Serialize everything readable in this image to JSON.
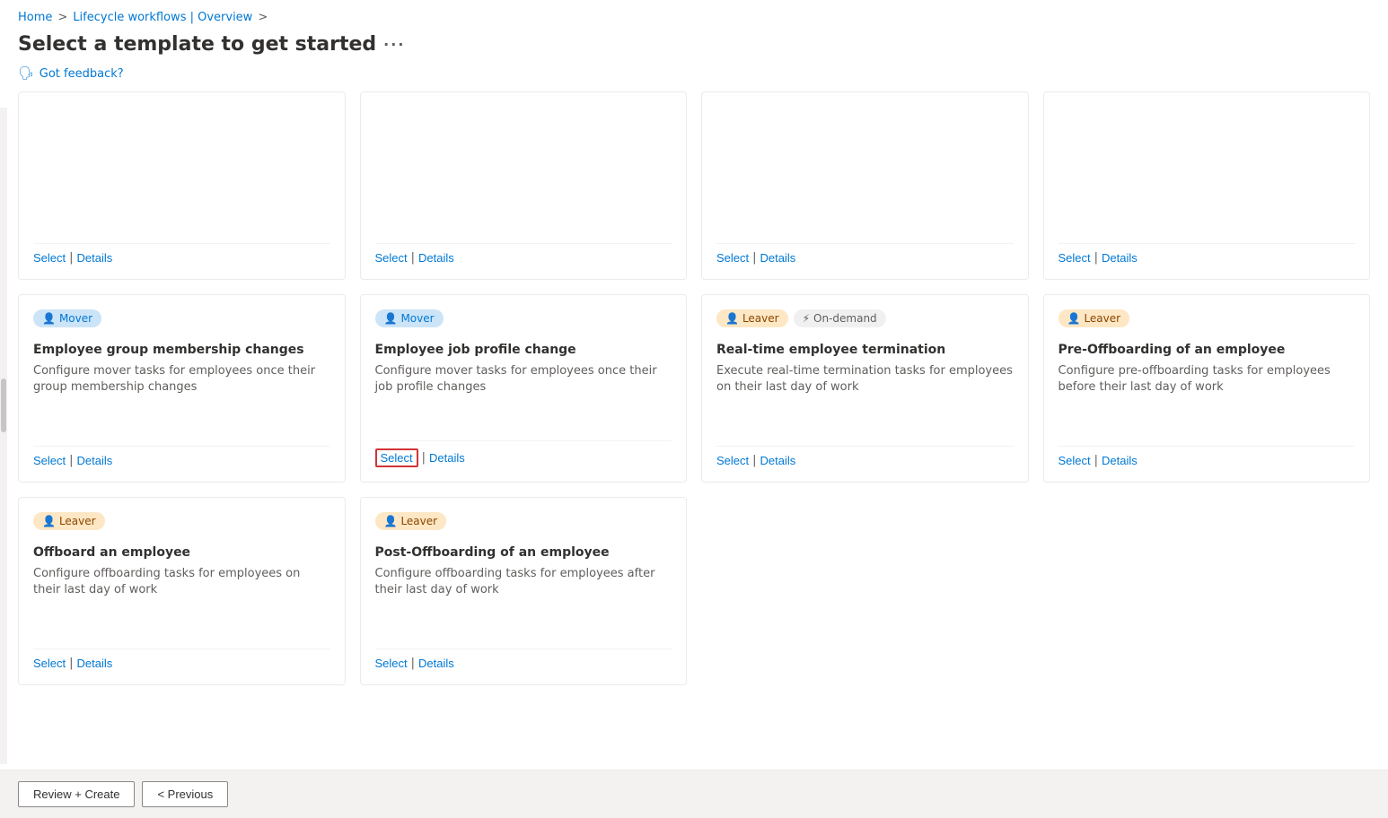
{
  "breadcrumb": {
    "home": "Home",
    "separator1": ">",
    "lifecycle": "Lifecycle workflows | Overview",
    "separator2": ">"
  },
  "page": {
    "title": "Select a template to get started",
    "more_label": "···",
    "feedback_label": "Got feedback?"
  },
  "cards": [
    {
      "id": "card-1",
      "badge_type": "joiner",
      "badge_label": "",
      "title": "",
      "desc": "",
      "select_label": "Select",
      "details_label": "Details",
      "highlighted": false
    },
    {
      "id": "card-2",
      "badge_type": "joiner",
      "badge_label": "",
      "title": "",
      "desc": "",
      "select_label": "Select",
      "details_label": "Details",
      "highlighted": false
    },
    {
      "id": "card-3",
      "badge_type": "joiner",
      "badge_label": "",
      "title": "",
      "desc": "",
      "select_label": "Select",
      "details_label": "Details",
      "highlighted": false
    },
    {
      "id": "card-4",
      "badge_type": "joiner",
      "badge_label": "",
      "title": "",
      "desc": "",
      "select_label": "Select",
      "details_label": "Details",
      "highlighted": false
    },
    {
      "id": "card-5",
      "badges": [
        {
          "type": "mover",
          "label": "Mover",
          "icon": "person"
        }
      ],
      "title": "Employee group membership changes",
      "desc": "Configure mover tasks for employees once their group membership changes",
      "select_label": "Select",
      "details_label": "Details",
      "highlighted": false
    },
    {
      "id": "card-6",
      "badges": [
        {
          "type": "mover",
          "label": "Mover",
          "icon": "person"
        }
      ],
      "title": "Employee job profile change",
      "desc": "Configure mover tasks for employees once their job profile changes",
      "select_label": "Select",
      "details_label": "Details",
      "highlighted": true
    },
    {
      "id": "card-7",
      "badges": [
        {
          "type": "leaver",
          "label": "Leaver",
          "icon": "person"
        },
        {
          "type": "ondemand",
          "label": "On-demand",
          "icon": "lightning"
        }
      ],
      "title": "Real-time employee termination",
      "desc": "Execute real-time termination tasks for employees on their last day of work",
      "select_label": "Select",
      "details_label": "Details",
      "highlighted": false
    },
    {
      "id": "card-8",
      "badges": [
        {
          "type": "leaver",
          "label": "Leaver",
          "icon": "person"
        }
      ],
      "title": "Pre-Offboarding of an employee",
      "desc": "Configure pre-offboarding tasks for employees before their last day of work",
      "select_label": "Select",
      "details_label": "Details",
      "highlighted": false
    },
    {
      "id": "card-9",
      "badges": [
        {
          "type": "leaver",
          "label": "Leaver",
          "icon": "person"
        }
      ],
      "title": "Offboard an employee",
      "desc": "Configure offboarding tasks for employees on their last day of work",
      "select_label": "Select",
      "details_label": "Details",
      "highlighted": false
    },
    {
      "id": "card-10",
      "badges": [
        {
          "type": "leaver",
          "label": "Leaver",
          "icon": "person"
        }
      ],
      "title": "Post-Offboarding of an employee",
      "desc": "Configure offboarding tasks for employees after their last day of work",
      "select_label": "Select",
      "details_label": "Details",
      "highlighted": false
    }
  ],
  "bottom_bar": {
    "review_create_label": "Review + Create",
    "previous_label": "< Previous"
  }
}
